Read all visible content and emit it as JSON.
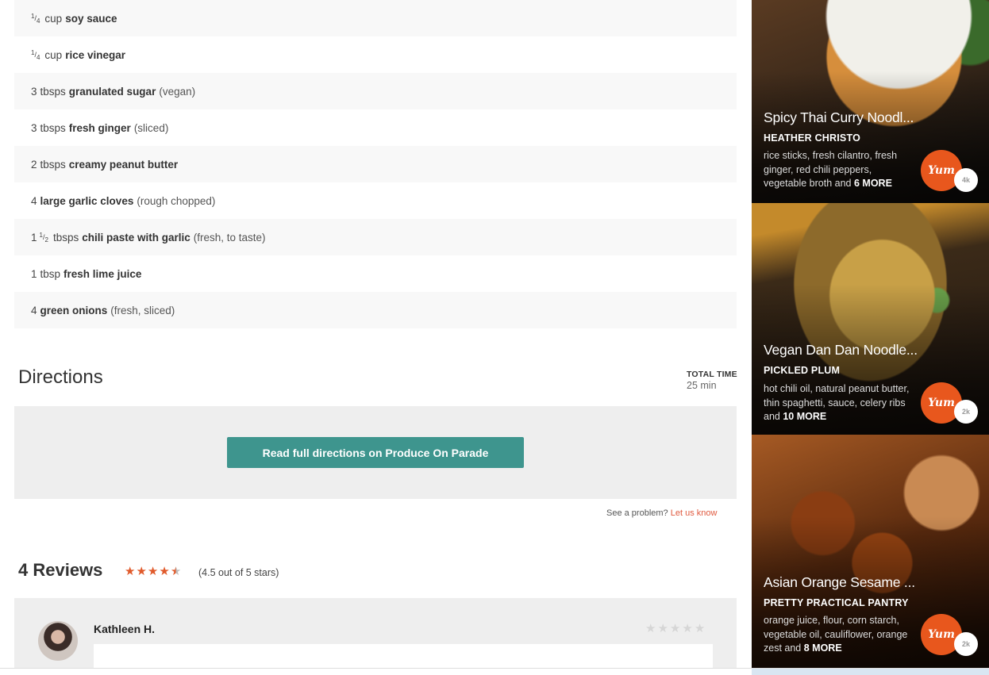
{
  "ingredients": [
    {
      "qty": "",
      "frac_num": "1",
      "frac_den": "4",
      "unit": "cup",
      "name": "soy sauce",
      "note": ""
    },
    {
      "qty": "",
      "frac_num": "1",
      "frac_den": "4",
      "unit": "cup",
      "name": "rice vinegar",
      "note": ""
    },
    {
      "qty": "3",
      "frac_num": "",
      "frac_den": "",
      "unit": "tbsps",
      "name": "granulated sugar",
      "note": "(vegan)"
    },
    {
      "qty": "3",
      "frac_num": "",
      "frac_den": "",
      "unit": "tbsps",
      "name": "fresh ginger",
      "note": "(sliced)"
    },
    {
      "qty": "2",
      "frac_num": "",
      "frac_den": "",
      "unit": "tbsps",
      "name": "creamy peanut butter",
      "note": ""
    },
    {
      "qty": "4",
      "frac_num": "",
      "frac_den": "",
      "unit": "",
      "name": "large garlic cloves",
      "note": "(rough chopped)"
    },
    {
      "qty": "1",
      "frac_num": "1",
      "frac_den": "2",
      "unit": "tbsps",
      "name": "chili paste with garlic",
      "note": "(fresh, to taste)"
    },
    {
      "qty": "1",
      "frac_num": "",
      "frac_den": "",
      "unit": "tbsp",
      "name": "fresh lime juice",
      "note": ""
    },
    {
      "qty": "4",
      "frac_num": "",
      "frac_den": "",
      "unit": "",
      "name": "green onions",
      "note": "(fresh, sliced)"
    }
  ],
  "directions": {
    "title": "Directions",
    "total_time_label": "TOTAL TIME",
    "total_time_value": "25 min",
    "button_label": "Read full directions on Produce On Parade"
  },
  "problem": {
    "text": "See a problem?",
    "link": "Let us know"
  },
  "reviews": {
    "title": "4 Reviews",
    "rating": 4.5,
    "rating_text": "(4.5 out of 5 stars)",
    "items": [
      {
        "name": "Kathleen H.",
        "stars": 0
      }
    ]
  },
  "sidebar": {
    "cards": [
      {
        "title": "Spicy Thai Curry Noodl...",
        "source": "HEATHER CHRISTO",
        "ingredients": "rice sticks, fresh cilantro, fresh ginger, red chili peppers, vegetable broth and",
        "more": "6 MORE",
        "yum": "Yum",
        "count": "4k"
      },
      {
        "title": "Vegan Dan Dan Noodle...",
        "source": "PICKLED PLUM",
        "ingredients": "hot chili oil, natural peanut butter, thin spaghetti, sauce, celery ribs and",
        "more": "10 MORE",
        "yum": "Yum",
        "count": "2k"
      },
      {
        "title": "Asian Orange Sesame ...",
        "source": "PRETTY PRACTICAL PANTRY",
        "ingredients": "orange juice, flour, corn starch, vegetable oil, cauliflower, orange zest and",
        "more": "8 MORE",
        "yum": "Yum",
        "count": "2k"
      }
    ]
  },
  "colors": {
    "accent_button": "#3e958e",
    "star": "#e05a2b",
    "yum_badge": "#e8571d",
    "link": "#e05a3f"
  }
}
